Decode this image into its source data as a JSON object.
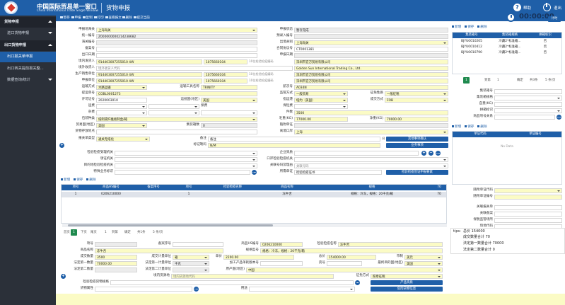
{
  "header": {
    "brand_cn": "中国国际贸易单一窗口",
    "brand_en": "China International Trade Single Window",
    "module": "货物申报",
    "help": "帮助",
    "exit": "退出"
  },
  "sidebar": [
    {
      "label": "货物申报",
      "type": "group",
      "caret": "up"
    },
    {
      "label": "进口货物申报",
      "type": "sub",
      "caret": "down"
    },
    {
      "label": "出口货物申报",
      "type": "group",
      "caret": "up"
    },
    {
      "label": "出口报关单申报",
      "type": "sub-active",
      "caret": ""
    },
    {
      "label": "出口转关提前报关整...",
      "type": "sub",
      "caret": ""
    },
    {
      "label": "数据查询/统计",
      "type": "sub",
      "caret": "down"
    }
  ],
  "toolbar": [
    "暂存",
    "申报",
    "复制",
    "打印",
    "查看报文",
    "删除",
    "提交当前"
  ],
  "timer": {
    "value": "00:00:00",
    "cancel": "计时"
  },
  "form": {
    "r1": {
      "l1": "申报地海关",
      "v1": "上海海关",
      "l2": "申报状态",
      "v2": "暂存完成"
    },
    "r2": {
      "l1": "统一编号",
      "v1": "Z000000000214238682",
      "l2": "预录入编号",
      "v2": ""
    },
    "r3": {
      "l1": "海关编号",
      "v1": "",
      "l2": "出境关别",
      "v2": "上海海关"
    },
    "r4": {
      "l1": "备案号",
      "v1": "",
      "l2": "合同协议号",
      "v2": "CT0001381"
    },
    "r5": {
      "l1": "出口日期",
      "v1": "",
      "l2": "申报日期",
      "v2": ""
    },
    "r6": {
      "l1": "境内发货人",
      "v1": "914403007255010 4W",
      "v2": "1075660104",
      "note": "10位检验检疫编码",
      "v3": "深圳市宜万贸易有限公司"
    },
    "r7": {
      "l1": "境外收货人",
      "v1": "境外收货人代码",
      "v2": "Golden Sun International Trading Co., Ltd."
    },
    "r8": {
      "l1": "生产销售单位",
      "v1": "914403007255010 4W",
      "v2": "1075660104",
      "note": "10位检验检疫编码",
      "v3": "深圳市宜万贸易有限公司"
    },
    "r9": {
      "l1": "申报单位",
      "v1": "914403007255010 4W",
      "v2": "1075660104",
      "note": "10位检验检疫编码",
      "v3": "深圳市宜万贸易有限公司"
    },
    "r10": {
      "l1": "运输方式",
      "v1": "水路运输",
      "l2": "运输工具名称",
      "v2": "TRINITY",
      "l3": "航次号",
      "v3": "A034N"
    },
    "r11": {
      "l1": "提运单号",
      "v1": "COBL0001273",
      "l2": "监管方式",
      "v2": "一般贸易",
      "l3": "征免性质",
      "v3": "一般征税"
    },
    "r12": {
      "l1": "许可证号",
      "v1": "2020003010",
      "l2": "运抵国(地区)",
      "v2": "美国",
      "l3": "指运港",
      "v3": "纽约（美国）",
      "l4": "成交方式",
      "v4": "FOB"
    },
    "r13": {
      "l1": "运费",
      "l2": "保费",
      "l3": "保险费"
    },
    "r14": {
      "l1": "杂费",
      "l2": "件数",
      "v2": "3500"
    },
    "r15": {
      "l1": "包装种类",
      "v1": "纸制或纤维板制盒/箱",
      "l2": "毛重(KG)",
      "v2": "77000.00",
      "l3": "净重(KG)",
      "v3": "70000.00"
    },
    "r16": {
      "l1": "贸易国(地区)",
      "v1": "美国",
      "l2": "集装箱数",
      "v2": "0",
      "l3": "随附单证",
      "v3": ""
    },
    "r17": {
      "l1": "货物存放地点",
      "v1": "",
      "l2": "离境口岸",
      "v2": "上海"
    },
    "r18": {
      "l1": "报关单类型",
      "v1": "通关无纸化",
      "l2": "备注",
      "v2": "备注",
      "l3": "其他事项确认",
      "btn": "其他事项确认"
    },
    "r19": {
      "l1": "标记唛码",
      "v1": "N/M",
      "btn": "业务事项"
    },
    "r20": {
      "l1": "检验检疫受理机关",
      "v1": "",
      "l2": "企业资质"
    },
    "r21": {
      "l1": "领证机关",
      "v1": "",
      "l2": "口岸检验检疫机关"
    },
    "r22": {
      "l1": "目的地检验检疫机关",
      "v1": "",
      "l2": "关联号码及理由",
      "v2": "关联号码"
    },
    "r23": {
      "l1": "特殊业务标识",
      "v1": "",
      "l2": "所需单证",
      "v2": "检验检疫证书",
      "btn": "检验检疫签证申报要素"
    }
  },
  "goods_toolbar": [
    "新增",
    "保存",
    "删除"
  ],
  "goods_grid": {
    "columns": [
      "项号",
      "商品HS编号",
      "备案序号",
      "项号",
      "检验检疫名称",
      "商品名称",
      "规格",
      "70"
    ],
    "rows": [
      [
        "1",
        "0206210000",
        "",
        "1",
        "",
        "冻牛舌",
        "冻牛舌",
        "规格：冷冻，规格：20千克/箱"
      ]
    ]
  },
  "goods_pager": {
    "first": "首页",
    "prev": "上页",
    "page": "1",
    "next": "下页",
    "last": "尾页",
    "goto": "到第",
    "total": "共1条",
    "size": "5 条/页",
    "confirm": "确定"
  },
  "goods_form": {
    "r1": {
      "l1": "项号",
      "v1": "",
      "l2": "备案序号",
      "v2": "",
      "l3": "商品HS编号",
      "v3": "0206210000",
      "l4": "检验检疫名称",
      "v4": "冻牛舌"
    },
    "r2": {
      "l1": "商品名称",
      "v1": "冻牛舌",
      "l2": "规格型号",
      "v2": "规格：冷冻，规格：20千克/箱"
    },
    "r3": {
      "l1": "成交数量",
      "v1": "3500",
      "l2": "成交计量单位",
      "v2": "箱",
      "l3": "单价",
      "v3": "2200.00",
      "l4": "总价",
      "v4": "154000.00",
      "l5": "币制",
      "v5": "美元"
    },
    "r4": {
      "l1": "法定第一数量",
      "v1": "70000.00",
      "l2": "法定第一计量单位",
      "v2": "千克",
      "l3": "加工产品单耗版本号",
      "l4": "货号",
      "l5": "最终目的国(地区)",
      "v5": "美国"
    },
    "r5": {
      "l1": "法定第二数量",
      "v1": "",
      "l2": "法定第二计量单位",
      "v2": "",
      "l3": "原产国(地区)",
      "v3": "中国"
    },
    "r6": {
      "l1": "境内货源地",
      "v1": "境内货源地代码",
      "l2": "征免方式",
      "v2": "照章征税"
    },
    "r7": {
      "l1": "检验检疫货物规格",
      "btn": "产品资质"
    },
    "r8": {
      "l1": "货物属性",
      "l2": "用途",
      "btn": "危险货物信息"
    }
  },
  "right_panel": {
    "toolbar": [
      "新增",
      "保存",
      "删除"
    ],
    "container_grid": {
      "columns": [
        "集装箱号",
        "集装箱规格",
        "拼箱标识"
      ],
      "rows": [
        [
          "BJYU0010205",
          "冷藏2*标准箱...",
          "否"
        ],
        [
          "BJYU0010412",
          "冷藏2*标准箱...",
          "否"
        ],
        [
          "BJYU0010790",
          "冷藏2*标准箱...",
          "否"
        ]
      ]
    },
    "pager": {
      "page": "1",
      "goto": "到第",
      "confirm": "确定",
      "total": "共3条",
      "size": "5 条/页"
    },
    "container_form": [
      {
        "label": "集装箱号",
        "value": ""
      },
      {
        "label": "集装箱规格",
        "value": ""
      },
      {
        "label": "自重(KG)",
        "value": ""
      },
      {
        "label": "拼箱标识",
        "value": ""
      },
      {
        "label": "商品项号关系",
        "value": ""
      }
    ],
    "doc_toolbar": [
      "新增",
      "保存",
      "删除"
    ],
    "doc_grid": {
      "columns": [
        "单证代码",
        "单证编号"
      ],
      "empty": "No Data"
    },
    "doc_form": [
      {
        "label": "随附单证代码",
        "value": ""
      },
      {
        "label": "随附单证编号",
        "value": ""
      }
    ],
    "relation": [
      {
        "label": "关联报关单",
        "value": ""
      },
      {
        "label": "关联备案",
        "value": ""
      },
      {
        "label": "保税监管场所",
        "value": ""
      },
      {
        "label": "场地代码",
        "value": ""
      }
    ]
  },
  "tips": {
    "title": "tips:",
    "total": "总价 154000",
    "qty": "成交数量合计 70",
    "law1": "法定第一数量合计 70000",
    "law2": "法定第二数量合计 0"
  }
}
